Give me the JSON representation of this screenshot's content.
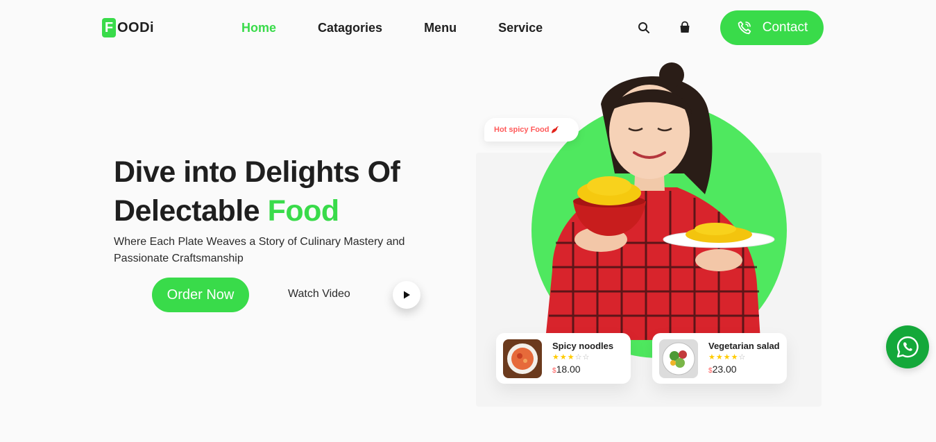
{
  "logo": {
    "badge": "F",
    "rest": "OODi"
  },
  "nav": {
    "links": [
      {
        "label": "Home"
      },
      {
        "label": "Catagories"
      },
      {
        "label": "Menu"
      },
      {
        "label": "Service"
      }
    ],
    "contact_label": "Contact"
  },
  "hero": {
    "title_line1": "Dive into Delights Of",
    "title_line2_prefix": "Delectable",
    "title_line2_accent": "Food",
    "subtitle": "Where Each Plate Weaves a Story of Culinary Mastery and Passionate Craftsmanship",
    "order_label": "Order Now",
    "watch_label": "Watch Video",
    "badge_text": "Hot spicy Food"
  },
  "cards": [
    {
      "name": "Spicy noodles",
      "rating": 3,
      "max": 5,
      "currency": "$",
      "price": "18.00"
    },
    {
      "name": "Vegetarian salad",
      "rating": 4,
      "max": 5,
      "currency": "$",
      "price": "23.00"
    }
  ],
  "colors": {
    "brand": "#39db4a",
    "text": "#1f1f1f",
    "price_accent": "#ff5a5a",
    "star": "#ffcb00",
    "whatsapp": "#14a83a"
  },
  "icons": [
    "search-icon",
    "shopping-bag-icon",
    "phone-icon",
    "play-icon",
    "chili-icon",
    "whatsapp-icon"
  ]
}
